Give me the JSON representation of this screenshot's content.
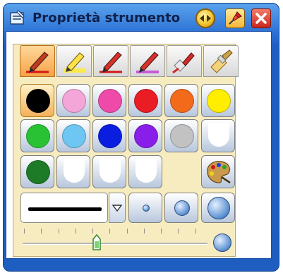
{
  "window": {
    "title": "Proprietà strumento",
    "icons": {
      "app": "tool-properties-icon",
      "nav": "navigate-arrows-icon",
      "pin": "pin-icon",
      "close": "close-icon"
    }
  },
  "tools": [
    {
      "name": "pen",
      "icon": "pen-icon",
      "active": true
    },
    {
      "name": "highlighter",
      "icon": "highlighter-icon",
      "active": false
    },
    {
      "name": "pen-2",
      "icon": "pen-icon",
      "active": false
    },
    {
      "name": "pen-3",
      "icon": "pen-icon",
      "active": false
    },
    {
      "name": "brush",
      "icon": "brush-icon",
      "active": false
    },
    {
      "name": "wide-brush",
      "icon": "wide-brush-icon",
      "active": false
    }
  ],
  "colors": [
    [
      "#000000",
      "#f4a6d8",
      "#ef4aa8",
      "#ea1c24",
      "#f46a1b",
      "#ffee00"
    ],
    [
      "#29c234",
      "#6dc7f2",
      "#0a1ee0",
      "#8a1ee9",
      "#c2c2c2",
      "empty"
    ],
    [
      "#1d7a26",
      "empty",
      "empty",
      "empty",
      "none",
      "palette"
    ]
  ],
  "selected_color": "#000000",
  "line_style": {
    "label": "solid-line",
    "options_icon": "dropdown-arrow-icon"
  },
  "sizes": [
    "small",
    "medium",
    "large"
  ],
  "transparency": 0.4
}
